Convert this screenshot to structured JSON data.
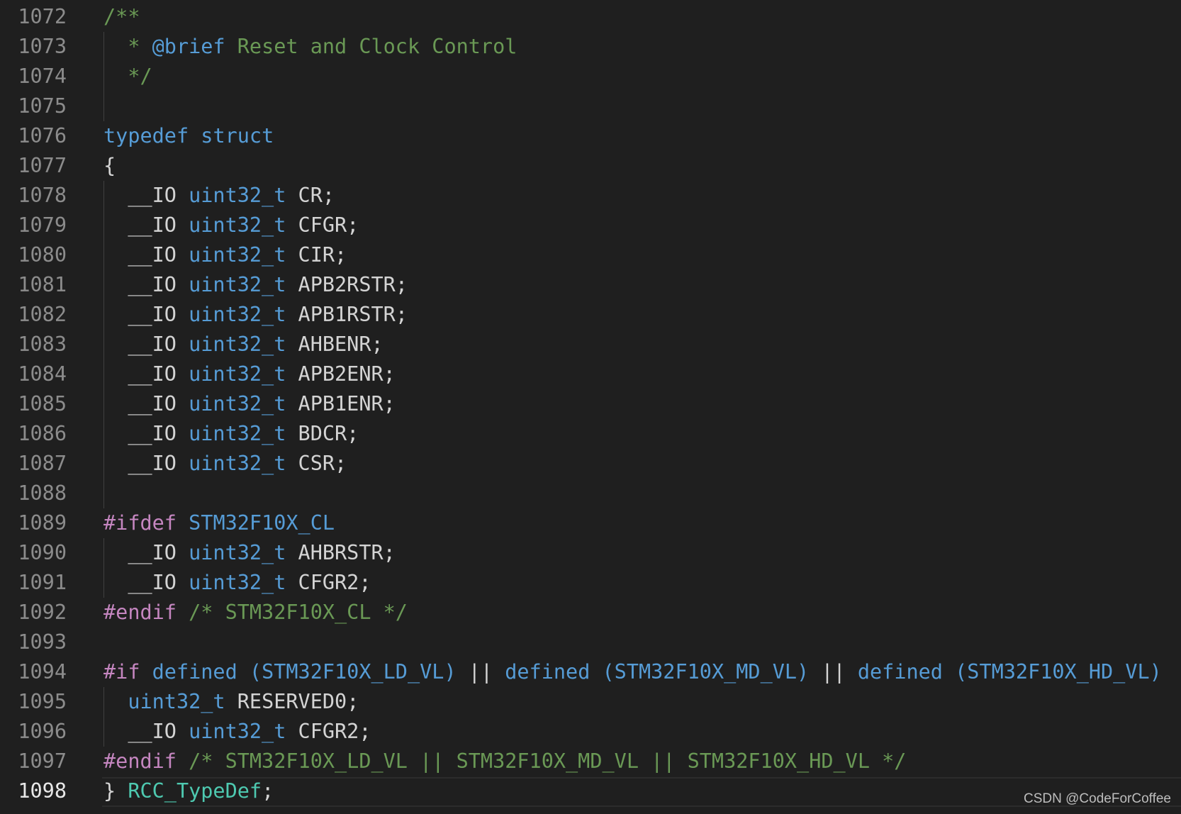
{
  "editor": {
    "lines": [
      {
        "number": "1072",
        "indent": 0,
        "guide": false,
        "tokens": [
          {
            "t": "/**",
            "k": "comment"
          }
        ]
      },
      {
        "number": "1073",
        "indent": 0,
        "guide": true,
        "tokens": [
          {
            "t": "  * ",
            "k": "comment"
          },
          {
            "t": "@brief",
            "k": "doctag"
          },
          {
            "t": " Reset and Clock Control",
            "k": "comment"
          }
        ]
      },
      {
        "number": "1074",
        "indent": 0,
        "guide": true,
        "tokens": [
          {
            "t": "  */",
            "k": "comment"
          }
        ]
      },
      {
        "number": "1075",
        "indent": 0,
        "guide": true,
        "tokens": []
      },
      {
        "number": "1076",
        "indent": 0,
        "guide": false,
        "tokens": [
          {
            "t": "typedef",
            "k": "keyword"
          },
          {
            "t": " ",
            "k": "plain"
          },
          {
            "t": "struct",
            "k": "keyword"
          }
        ]
      },
      {
        "number": "1077",
        "indent": 0,
        "guide": false,
        "tokens": [
          {
            "t": "{",
            "k": "punct"
          }
        ]
      },
      {
        "number": "1078",
        "indent": 1,
        "guide": true,
        "tokens": [
          {
            "t": "  __IO ",
            "k": "plain"
          },
          {
            "t": "uint32_t",
            "k": "type"
          },
          {
            "t": " CR;",
            "k": "plain"
          }
        ]
      },
      {
        "number": "1079",
        "indent": 1,
        "guide": true,
        "tokens": [
          {
            "t": "  __IO ",
            "k": "plain"
          },
          {
            "t": "uint32_t",
            "k": "type"
          },
          {
            "t": " CFGR;",
            "k": "plain"
          }
        ]
      },
      {
        "number": "1080",
        "indent": 1,
        "guide": true,
        "tokens": [
          {
            "t": "  __IO ",
            "k": "plain"
          },
          {
            "t": "uint32_t",
            "k": "type"
          },
          {
            "t": " CIR;",
            "k": "plain"
          }
        ]
      },
      {
        "number": "1081",
        "indent": 1,
        "guide": true,
        "tokens": [
          {
            "t": "  __IO ",
            "k": "plain"
          },
          {
            "t": "uint32_t",
            "k": "type"
          },
          {
            "t": " APB2RSTR;",
            "k": "plain"
          }
        ]
      },
      {
        "number": "1082",
        "indent": 1,
        "guide": true,
        "tokens": [
          {
            "t": "  __IO ",
            "k": "plain"
          },
          {
            "t": "uint32_t",
            "k": "type"
          },
          {
            "t": " APB1RSTR;",
            "k": "plain"
          }
        ]
      },
      {
        "number": "1083",
        "indent": 1,
        "guide": true,
        "tokens": [
          {
            "t": "  __IO ",
            "k": "plain"
          },
          {
            "t": "uint32_t",
            "k": "type"
          },
          {
            "t": " AHBENR;",
            "k": "plain"
          }
        ]
      },
      {
        "number": "1084",
        "indent": 1,
        "guide": true,
        "tokens": [
          {
            "t": "  __IO ",
            "k": "plain"
          },
          {
            "t": "uint32_t",
            "k": "type"
          },
          {
            "t": " APB2ENR;",
            "k": "plain"
          }
        ]
      },
      {
        "number": "1085",
        "indent": 1,
        "guide": true,
        "tokens": [
          {
            "t": "  __IO ",
            "k": "plain"
          },
          {
            "t": "uint32_t",
            "k": "type"
          },
          {
            "t": " APB1ENR;",
            "k": "plain"
          }
        ]
      },
      {
        "number": "1086",
        "indent": 1,
        "guide": true,
        "tokens": [
          {
            "t": "  __IO ",
            "k": "plain"
          },
          {
            "t": "uint32_t",
            "k": "type"
          },
          {
            "t": " BDCR;",
            "k": "plain"
          }
        ]
      },
      {
        "number": "1087",
        "indent": 1,
        "guide": true,
        "tokens": [
          {
            "t": "  __IO ",
            "k": "plain"
          },
          {
            "t": "uint32_t",
            "k": "type"
          },
          {
            "t": " CSR;",
            "k": "plain"
          }
        ]
      },
      {
        "number": "1088",
        "indent": 1,
        "guide": true,
        "tokens": []
      },
      {
        "number": "1089",
        "indent": 0,
        "guide": false,
        "tokens": [
          {
            "t": "#ifdef",
            "k": "preproc"
          },
          {
            "t": " ",
            "k": "plain"
          },
          {
            "t": "STM32F10X_CL",
            "k": "macro"
          }
        ]
      },
      {
        "number": "1090",
        "indent": 1,
        "guide": true,
        "tokens": [
          {
            "t": "  __IO ",
            "k": "plain"
          },
          {
            "t": "uint32_t",
            "k": "type"
          },
          {
            "t": " AHBRSTR;",
            "k": "plain"
          }
        ]
      },
      {
        "number": "1091",
        "indent": 1,
        "guide": true,
        "tokens": [
          {
            "t": "  __IO ",
            "k": "plain"
          },
          {
            "t": "uint32_t",
            "k": "type"
          },
          {
            "t": " CFGR2;",
            "k": "plain"
          }
        ]
      },
      {
        "number": "1092",
        "indent": 0,
        "guide": false,
        "tokens": [
          {
            "t": "#endif",
            "k": "preproc"
          },
          {
            "t": " /* STM32F10X_CL */",
            "k": "comment"
          }
        ]
      },
      {
        "number": "1093",
        "indent": 0,
        "guide": false,
        "tokens": []
      },
      {
        "number": "1094",
        "indent": 0,
        "guide": false,
        "tokens": [
          {
            "t": "#if",
            "k": "preproc"
          },
          {
            "t": " defined (STM32F10X_LD_VL)",
            "k": "macro"
          },
          {
            "t": " || ",
            "k": "plain"
          },
          {
            "t": "defined (STM32F10X_MD_VL)",
            "k": "macro"
          },
          {
            "t": " || ",
            "k": "plain"
          },
          {
            "t": "defined (STM32F10X_HD_VL)",
            "k": "macro"
          }
        ]
      },
      {
        "number": "1095",
        "indent": 1,
        "guide": true,
        "tokens": [
          {
            "t": "  ",
            "k": "plain"
          },
          {
            "t": "uint32_t",
            "k": "type"
          },
          {
            "t": " RESERVED0;",
            "k": "plain"
          }
        ]
      },
      {
        "number": "1096",
        "indent": 1,
        "guide": true,
        "tokens": [
          {
            "t": "  __IO ",
            "k": "plain"
          },
          {
            "t": "uint32_t",
            "k": "type"
          },
          {
            "t": " CFGR2;",
            "k": "plain"
          }
        ]
      },
      {
        "number": "1097",
        "indent": 0,
        "guide": false,
        "tokens": [
          {
            "t": "#endif",
            "k": "preproc"
          },
          {
            "t": " /* STM32F10X_LD_VL || STM32F10X_MD_VL || STM32F10X_HD_VL */",
            "k": "comment"
          }
        ]
      },
      {
        "number": "1098",
        "indent": 0,
        "guide": false,
        "current": true,
        "tokens": [
          {
            "t": "} ",
            "k": "punct"
          },
          {
            "t": "RCC_TypeDef",
            "k": "typename"
          },
          {
            "t": ";",
            "k": "punct"
          }
        ]
      }
    ]
  },
  "watermark": {
    "text": "CSDN @CodeForCoffee"
  },
  "colors": {
    "background": "#1f1f1f",
    "comment": "#6a9955",
    "keyword": "#569cd6",
    "preprocessor": "#c586c0",
    "typename": "#4ec9b0",
    "plain": "#d4d4d4",
    "line_number": "#8c8c8c"
  }
}
